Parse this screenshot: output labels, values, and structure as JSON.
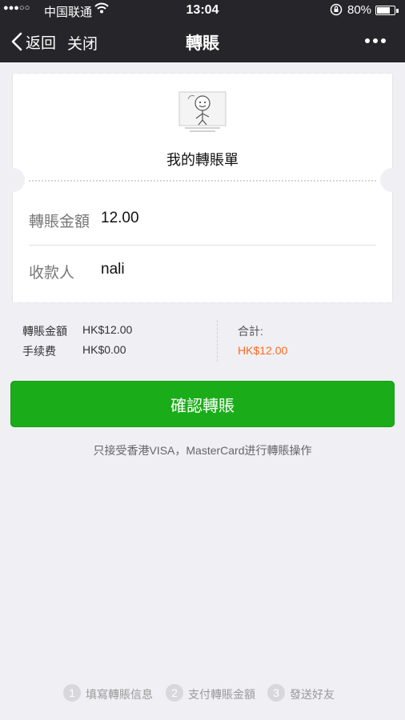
{
  "status_bar": {
    "signal": "●●●○○",
    "carrier": "中国联通",
    "time": "13:04",
    "battery": "80%",
    "battery_level": 0.8
  },
  "nav": {
    "back_label": "返回",
    "close_label": "关闭",
    "title": "轉賬"
  },
  "ticket": {
    "title": "我的轉賬單",
    "rows": [
      {
        "label": "轉賬金額",
        "value": "12.00"
      },
      {
        "label": "收款人",
        "value": "nali"
      }
    ]
  },
  "summary": {
    "amount_label": "轉賬金額",
    "amount_value": "HK$12.00",
    "fee_label": "手续费",
    "fee_value": "HK$0.00",
    "total_label": "合計:",
    "total_value": "HK$12.00"
  },
  "confirm_button": "確認轉賬",
  "notice": "只接受香港VISA，MasterCard进行轉賬操作",
  "steps": [
    {
      "number": "1",
      "label": "填寫轉賬信息"
    },
    {
      "number": "2",
      "label": "支付轉賬金額"
    },
    {
      "number": "3",
      "label": "發送好友"
    }
  ],
  "colors": {
    "nav_bg": "#26262a",
    "accent_green": "#1aad19",
    "total_orange": "#ff6a22",
    "page_bg": "#efeff4"
  },
  "icons": [
    "signal-icon",
    "wifi-icon",
    "lock-rotation-icon",
    "battery-icon",
    "back-chevron-icon",
    "more-dots-icon",
    "avatar-image"
  ]
}
